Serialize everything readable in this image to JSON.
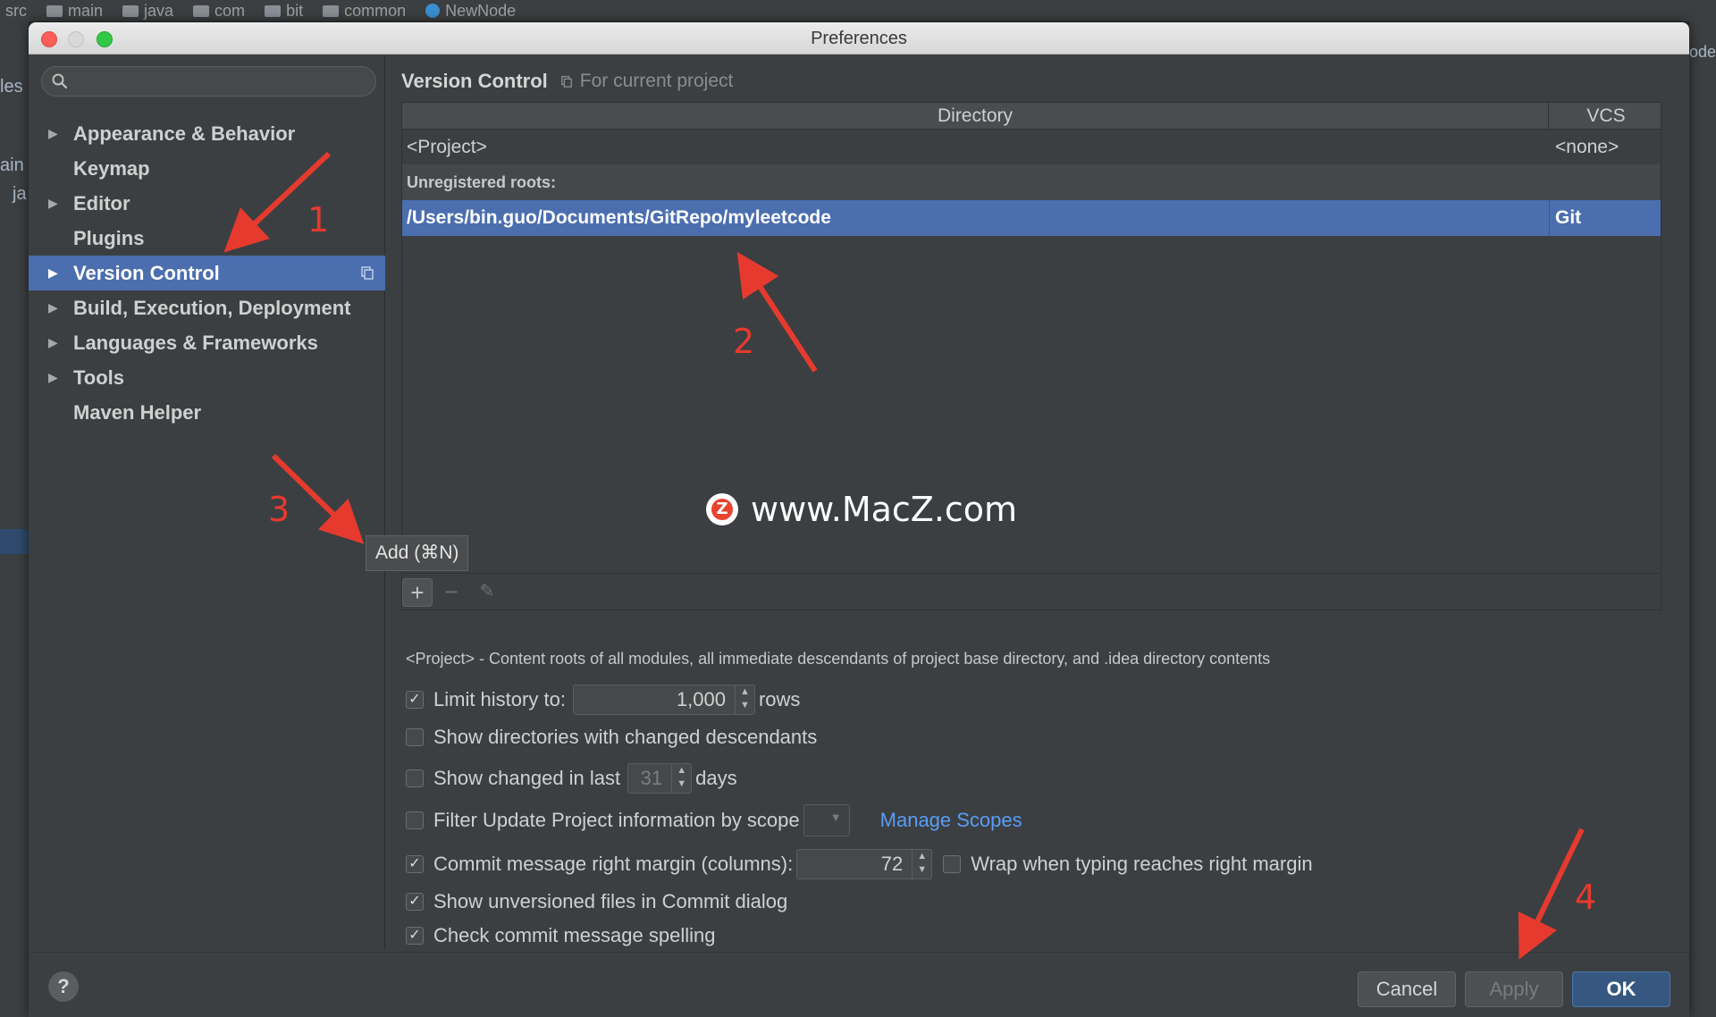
{
  "background": {
    "breadcrumb": [
      "src",
      "main",
      "java",
      "com",
      "bit",
      "common",
      "NewNode"
    ],
    "left_fragments": [
      "les",
      "ain",
      "ja"
    ],
    "right_fragments": [
      "ode"
    ]
  },
  "dialog": {
    "title": "Preferences",
    "search": {
      "placeholder": "",
      "value": ""
    },
    "sidebar": {
      "items": [
        {
          "label": "Appearance & Behavior",
          "expandable": true,
          "active": false
        },
        {
          "label": "Keymap",
          "expandable": false,
          "active": false
        },
        {
          "label": "Editor",
          "expandable": true,
          "active": false
        },
        {
          "label": "Plugins",
          "expandable": false,
          "active": false
        },
        {
          "label": "Version Control",
          "expandable": true,
          "active": true
        },
        {
          "label": "Build, Execution, Deployment",
          "expandable": true,
          "active": false
        },
        {
          "label": "Languages & Frameworks",
          "expandable": true,
          "active": false
        },
        {
          "label": "Tools",
          "expandable": true,
          "active": false
        },
        {
          "label": "Maven Helper",
          "expandable": false,
          "active": false
        }
      ]
    },
    "content": {
      "title": "Version Control",
      "scope_label": "For current project",
      "table": {
        "columns": [
          "Directory",
          "VCS"
        ],
        "project_row": {
          "directory": "<Project>",
          "vcs": "<none>"
        },
        "group_label": "Unregistered roots:",
        "selected_row": {
          "directory": "/Users/bin.guo/Documents/GitRepo/myleetcode",
          "vcs": "Git"
        }
      },
      "toolbar": {
        "add": "+",
        "remove": "−",
        "edit": "✎",
        "add_tooltip": "Add (⌘N)"
      },
      "hint": "<Project> - Content roots of all modules, all immediate descendants of project base directory, and .idea directory contents",
      "options": {
        "limit_history": {
          "label": "Limit history to:",
          "value": "1,000",
          "suffix": "rows",
          "checked": true
        },
        "show_dirs_changed": {
          "label": "Show directories with changed descendants",
          "checked": false
        },
        "show_changed_last": {
          "label": "Show changed in last",
          "value": "31",
          "suffix": "days",
          "checked": false
        },
        "filter_update": {
          "label": "Filter Update Project information by scope",
          "link": "Manage Scopes",
          "checked": false
        },
        "commit_margin": {
          "label": "Commit message right margin (columns):",
          "value": "72",
          "checked": true
        },
        "wrap_typing": {
          "label": "Wrap when typing reaches right margin",
          "checked": false
        },
        "show_unversioned": {
          "label": "Show unversioned files in Commit dialog",
          "checked": true
        },
        "check_spelling": {
          "label": "Check commit message spelling",
          "checked": true
        }
      }
    },
    "footer": {
      "help": "?",
      "cancel": "Cancel",
      "apply": "Apply",
      "ok": "OK"
    }
  },
  "annotations": {
    "numbers": [
      "1",
      "2",
      "3",
      "4"
    ],
    "color": "#e63a2e"
  },
  "watermark": {
    "text": "www.MacZ.com",
    "logo_letter": "Z"
  },
  "colors": {
    "accent": "#4b6eaf",
    "link": "#589df6",
    "panel": "#3c3f41"
  }
}
